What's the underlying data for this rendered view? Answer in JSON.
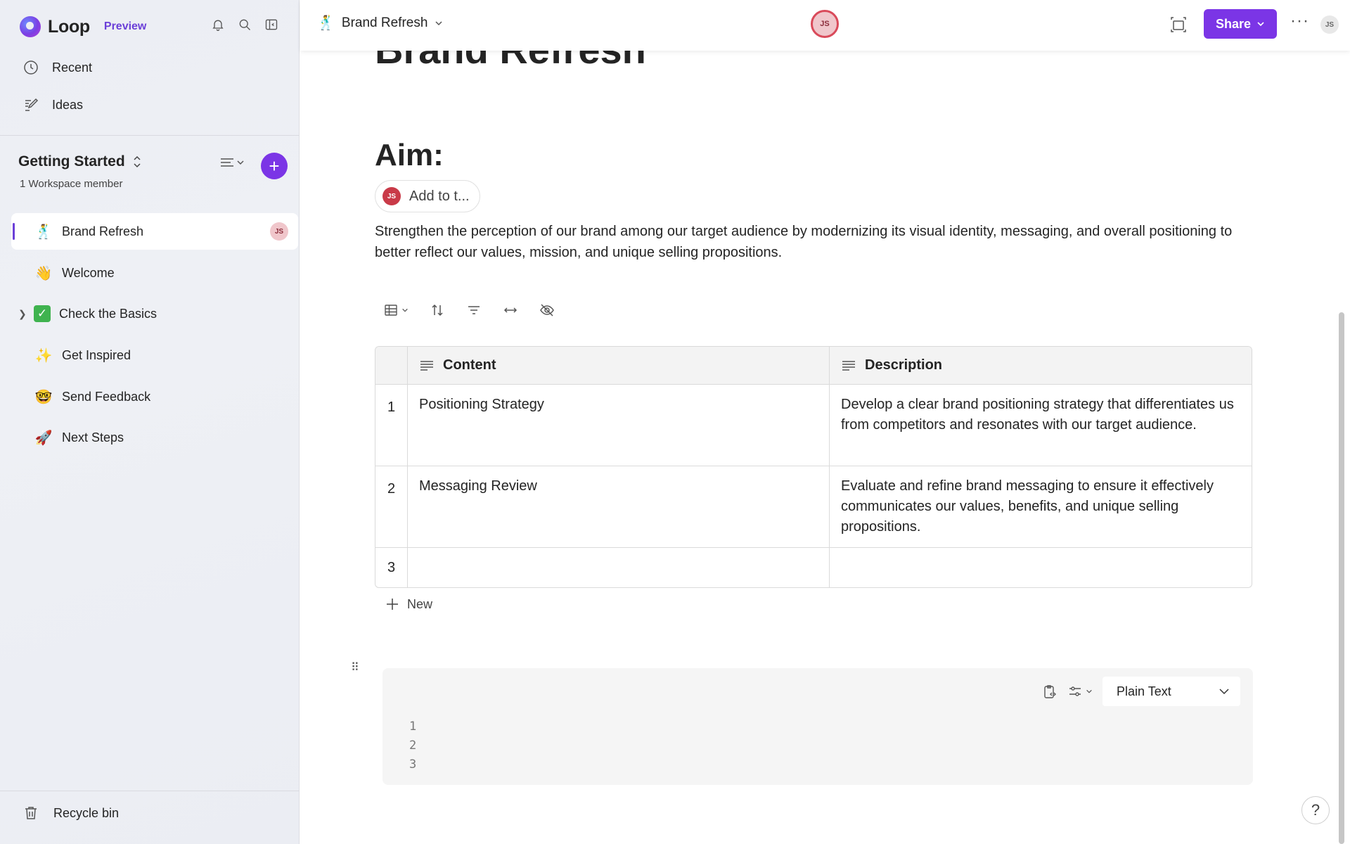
{
  "app": {
    "name": "Loop",
    "badge": "Preview"
  },
  "sidebar": {
    "nav": [
      {
        "label": "Recent",
        "icon": "clock-icon"
      },
      {
        "label": "Ideas",
        "icon": "pencil-note-icon"
      }
    ],
    "workspace": {
      "title": "Getting Started",
      "members": "1 Workspace member"
    },
    "pages": [
      {
        "label": "Brand Refresh",
        "emoji": "🕺",
        "active": true,
        "avatar": "JS"
      },
      {
        "label": "Welcome",
        "emoji": "👋"
      },
      {
        "label": "Check the Basics",
        "emoji": "✓",
        "expandable": true
      },
      {
        "label": "Get Inspired",
        "emoji": "✨"
      },
      {
        "label": "Send Feedback",
        "emoji": "🤓"
      },
      {
        "label": "Next Steps",
        "emoji": "🚀"
      }
    ],
    "recycle": "Recycle bin"
  },
  "header": {
    "breadcrumb": {
      "emoji": "🕺",
      "label": "Brand Refresh"
    },
    "collaborator": "JS",
    "share_label": "Share",
    "more": "···",
    "user_avatar": "JS"
  },
  "doc": {
    "title": "Brand Refresh",
    "heading": "Aim:",
    "assign": {
      "avatar": "JS",
      "label": "Add to t..."
    },
    "paragraph": "Strengthen the perception of our brand among our target audience by modernizing its visual identity, messaging, and overall positioning to better reflect our values, mission, and unique selling propositions.",
    "table": {
      "columns": [
        "Content",
        "Description"
      ],
      "rows": [
        {
          "num": "1",
          "content": "Positioning Strategy",
          "description": "Develop a clear brand positioning strategy that differentiates us from competitors and resonates with our target audience."
        },
        {
          "num": "2",
          "content": "Messaging Review",
          "description": "Evaluate and refine brand messaging to ensure it effectively communicates our values, benefits, and unique selling propositions."
        },
        {
          "num": "3",
          "content": "",
          "description": ""
        }
      ],
      "new_label": "New"
    },
    "code_block": {
      "language": "Plain Text",
      "lines": [
        "1",
        "2",
        "3"
      ]
    }
  },
  "help": "?",
  "colors": {
    "accent": "#7b35e6",
    "avatar_red": "#c93a48",
    "check_green": "#3fb34f"
  }
}
